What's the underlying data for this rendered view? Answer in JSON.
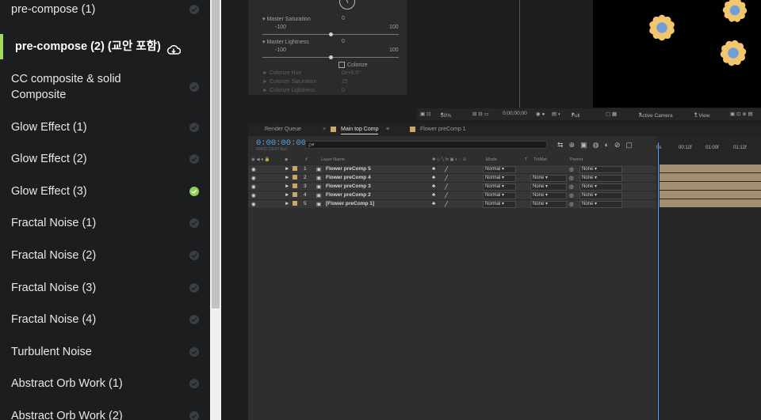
{
  "sidebar": {
    "lessons": [
      {
        "label": "pre-compose (1)",
        "status": "pending"
      },
      {
        "label": "pre-compose (2) (교안 포함)",
        "status": "active"
      },
      {
        "label": "CC composite & solid Composite",
        "status": "pending"
      },
      {
        "label": "Glow Effect (1)",
        "status": "pending"
      },
      {
        "label": "Glow Effect (2)",
        "status": "pending"
      },
      {
        "label": "Glow Effect (3)",
        "status": "done"
      },
      {
        "label": "Fractal Noise (1)",
        "status": "pending"
      },
      {
        "label": "Fractal Noise (2)",
        "status": "pending"
      },
      {
        "label": "Fractal Noise (3)",
        "status": "pending"
      },
      {
        "label": "Fractal Noise (4)",
        "status": "pending"
      },
      {
        "label": "Turbulent Noise",
        "status": "pending"
      },
      {
        "label": "Abstract Orb Work (1)",
        "status": "pending"
      },
      {
        "label": "Abstract Orb Work (2)",
        "status": "pending"
      }
    ],
    "colors": {
      "background": "#1c1d1f",
      "accent": "#a3d95c",
      "done": "#8ed154"
    }
  },
  "effects": {
    "master_saturation": {
      "label": "Master Saturation",
      "value": "0",
      "min": "-100",
      "max": "100",
      "level": 0.5
    },
    "master_lightness": {
      "label": "Master Lightness",
      "value": "0",
      "min": "-100",
      "max": "100",
      "level": 0.5
    },
    "colorize": "Colorize",
    "colorize_hue": {
      "label": "Colorize Hue",
      "value": "0x+0.0°"
    },
    "colorize_saturation": {
      "label": "Colorize Saturation",
      "value": "25"
    },
    "colorize_lightness": {
      "label": "Colorize Lightness",
      "value": "0"
    }
  },
  "viewer": {
    "zoom": "50%",
    "timecode": "0;00;00;00",
    "resolution": "Full",
    "camera": "Active Camera",
    "view": "1 View"
  },
  "tabs": {
    "render_queue": "Render Queue",
    "main": "Main top Comp",
    "flower": "Flower preComp 1"
  },
  "timeline": {
    "timecode": "0:00:00:00",
    "fps": "00000 (29.97 fps)",
    "search_placeholder": "ρ▾",
    "columns": {
      "num": "#",
      "layer_name": "Layer Name",
      "mode": "Mode",
      "t": "T",
      "trkmat": "TrkMat",
      "parent": "Parent"
    },
    "layers": [
      {
        "num": "1",
        "name": "Flower preComp 5",
        "mode": "Normal",
        "trkmat": "",
        "parent": "None"
      },
      {
        "num": "2",
        "name": "Flower preComp 4",
        "mode": "Normal",
        "trkmat": "None",
        "parent": "None"
      },
      {
        "num": "3",
        "name": "Flower preComp 3",
        "mode": "Normal",
        "trkmat": "None",
        "parent": "None"
      },
      {
        "num": "4",
        "name": "Flower preComp 2",
        "mode": "Normal",
        "trkmat": "None",
        "parent": "None"
      },
      {
        "num": "5",
        "name": "[Flower preComp 1]",
        "mode": "Normal",
        "trkmat": "None",
        "parent": "None"
      }
    ],
    "ruler": [
      "0s",
      "00:12f",
      "01:00f",
      "01:12f"
    ],
    "colors": {
      "timecode": "#4fa3e8",
      "layer_bar": "#a48e71"
    }
  }
}
